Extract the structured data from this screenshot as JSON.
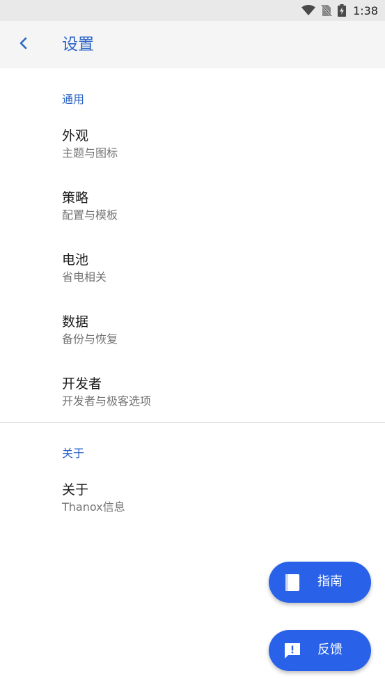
{
  "status_bar": {
    "time": "1:38",
    "icons": [
      "wifi-icon",
      "no-sim-icon",
      "battery-charging-icon"
    ]
  },
  "app_bar": {
    "back_icon": "chevron-left-icon",
    "title": "设置"
  },
  "sections": {
    "general": {
      "header": "通用",
      "items": [
        {
          "title": "外观",
          "summary": "主题与图标"
        },
        {
          "title": "策略",
          "summary": "配置与模板"
        },
        {
          "title": "电池",
          "summary": "省电相关"
        },
        {
          "title": "数据",
          "summary": "备份与恢复"
        },
        {
          "title": "开发者",
          "summary": "开发者与极客选项"
        }
      ]
    },
    "about": {
      "header": "关于",
      "items": [
        {
          "title": "关于",
          "summary": "Thanox信息"
        }
      ]
    }
  },
  "fabs": {
    "guide": {
      "label": "指南",
      "icon": "book-icon"
    },
    "feedback": {
      "label": "反馈",
      "icon": "feedback-icon"
    }
  },
  "colors": {
    "accent": "#2b63c6",
    "fab": "#2962e9",
    "app_bar_bg": "#f5f5f5",
    "status_bar_bg": "#e9e9e9"
  }
}
